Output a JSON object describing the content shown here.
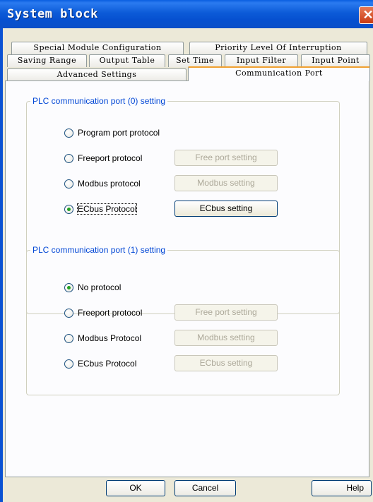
{
  "window": {
    "title": "System block",
    "close_glyph": "✕"
  },
  "tabs": {
    "row1": [
      {
        "label": "Special Module Configuration"
      },
      {
        "label": "Priority Level Of Interruption"
      }
    ],
    "row2": [
      {
        "label": "Saving Range"
      },
      {
        "label": "Output Table"
      },
      {
        "label": "Set Time"
      },
      {
        "label": "Input Filter"
      },
      {
        "label": "Input Point"
      }
    ],
    "row3": [
      {
        "label": "Advanced Settings"
      },
      {
        "label": "Communication Port",
        "active": true
      }
    ]
  },
  "port0": {
    "title": "PLC communication port (0) setting",
    "options": [
      {
        "label": "Program port protocol",
        "selected": false
      },
      {
        "label": "Freeport protocol",
        "selected": false,
        "button": "Free port setting",
        "button_enabled": false
      },
      {
        "label": "Modbus protocol",
        "selected": false,
        "button": "Modbus setting",
        "button_enabled": false
      },
      {
        "label": "ECbus Protocol",
        "selected": true,
        "button": "ECbus setting",
        "button_enabled": true
      }
    ]
  },
  "port1": {
    "title": "PLC communication port (1) setting",
    "options": [
      {
        "label": "No protocol",
        "selected": true
      },
      {
        "label": "Freeport protocol",
        "selected": false,
        "button": "Free port setting",
        "button_enabled": false
      },
      {
        "label": "Modbus Protocol",
        "selected": false,
        "button": "Modbus setting",
        "button_enabled": false
      },
      {
        "label": "ECbus Protocol",
        "selected": false,
        "button": "ECbus setting",
        "button_enabled": false
      }
    ]
  },
  "footer": {
    "ok": "OK",
    "cancel": "Cancel",
    "help": "Help"
  },
  "colors": {
    "title_bar": "#0a54d8",
    "active_tab_accent": "#f0a030",
    "group_title": "#0046d5",
    "selected_radio": "#21a121"
  }
}
